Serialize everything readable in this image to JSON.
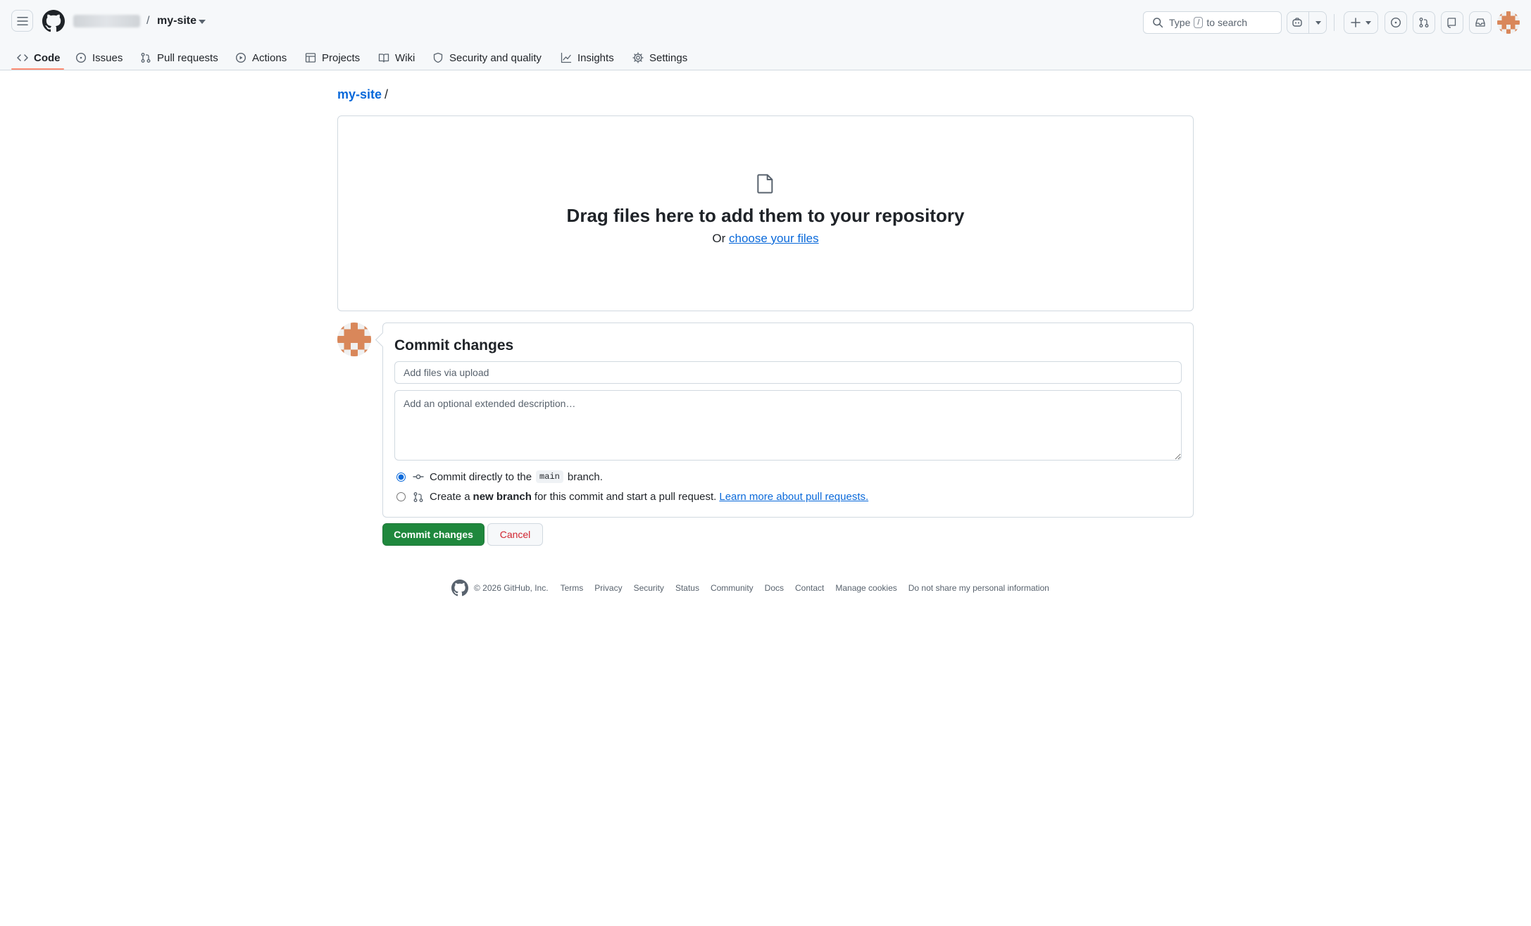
{
  "header": {
    "repo_name": "my-site",
    "crumb_separator": "/",
    "search": {
      "prefix": "Type",
      "key": "/",
      "suffix": "to search"
    }
  },
  "repo_nav": {
    "items": [
      {
        "label": "Code",
        "icon": "code-icon",
        "selected": true
      },
      {
        "label": "Issues",
        "icon": "issue-opened-icon"
      },
      {
        "label": "Pull requests",
        "icon": "git-pull-request-icon"
      },
      {
        "label": "Actions",
        "icon": "play-icon"
      },
      {
        "label": "Projects",
        "icon": "table-icon"
      },
      {
        "label": "Wiki",
        "icon": "book-icon"
      },
      {
        "label": "Security and quality",
        "icon": "shield-icon"
      },
      {
        "label": "Insights",
        "icon": "graph-icon"
      },
      {
        "label": "Settings",
        "icon": "gear-icon"
      }
    ],
    "accent_color": "#fd8c73"
  },
  "breadcrumb": {
    "repo": "my-site",
    "separator": "/"
  },
  "dropzone": {
    "title": "Drag files here to add them to your repository",
    "sub_prefix": "Or",
    "sub_link": "choose your files"
  },
  "commit": {
    "title": "Commit changes",
    "message_placeholder": "Add files via upload",
    "description_placeholder": "Add an optional extended description…",
    "option_direct": {
      "prefix": "Commit directly to the",
      "branch": "main",
      "suffix": "branch.",
      "selected": true
    },
    "option_new_branch": {
      "prefix": "Create a",
      "bold": "new branch",
      "suffix": "for this commit and start a pull request.",
      "link": "Learn more about pull requests.",
      "selected": false
    },
    "submit_label": "Commit changes",
    "cancel_label": "Cancel"
  },
  "footer": {
    "copyright": "© 2026 GitHub, Inc.",
    "links": [
      "Terms",
      "Privacy",
      "Security",
      "Status",
      "Community",
      "Docs",
      "Contact",
      "Manage cookies",
      "Do not share my personal information"
    ]
  },
  "colors": {
    "link": "#0969da",
    "primary_button": "#1f883d",
    "danger_text": "#d1242f",
    "border": "#d1d9e0"
  }
}
